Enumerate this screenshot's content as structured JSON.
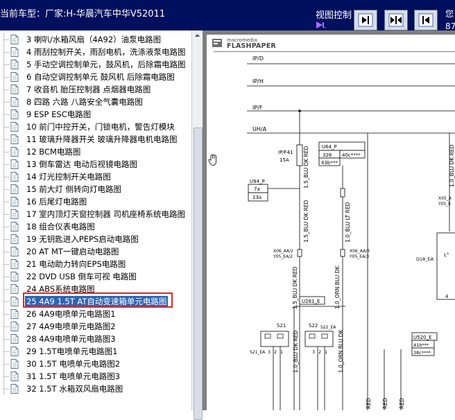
{
  "header": {
    "title_prefix": "当前车型：",
    "title_vehicle": "厂家:H-华晨汽车中华V52011",
    "view_control_label": "视图控制",
    "user_label_line1": "您",
    "user_label_line2": "87",
    "buttons": [
      "next-page-button",
      "fit-width-button",
      "prev-page-button"
    ]
  },
  "tree": {
    "items": [
      {
        "label": "3 喇叭/水箱风扇（4A92）油泵电路图"
      },
      {
        "label": "4 雨刮控制开关，雨刮电机，洗涤液泵电路图"
      },
      {
        "label": "5 手动空调控制单元，鼓风机，后除霜电路图"
      },
      {
        "label": "6 自动空调控制单元 鼓风机 后除霜电路图"
      },
      {
        "label": "7 收音机 胎压控制器 点烟器电路图"
      },
      {
        "label": "8 四路 六路 八路安全气囊电路图"
      },
      {
        "label": "9 ESP ESC电路图"
      },
      {
        "label": "10 前门中控开关，门锁电机，警告灯模块"
      },
      {
        "label": "11 玻璃升降器开关 玻璃升降器电机电路图"
      },
      {
        "label": "12 BCM电路图"
      },
      {
        "label": "13 倒车雷达 电动后视镜电路图"
      },
      {
        "label": "14 灯光控制开关电路图"
      },
      {
        "label": "15 前大灯 侧转向灯电路图"
      },
      {
        "label": "16 后尾灯电路图"
      },
      {
        "label": "17 室内顶灯天窗控制器 司机座椅系统电路图"
      },
      {
        "label": "18 组合仪表电路图"
      },
      {
        "label": "19 无钥匙进入PEPS启动电路图"
      },
      {
        "label": "20 AT MT一键启动电路图"
      },
      {
        "label": "21 电动助力转向EPS电路图"
      },
      {
        "label": "22 DVD USB 倒车可视 电路图"
      },
      {
        "label": "24 ABS系统电路图"
      },
      {
        "label": "25 4A9 1.5T AT自动变速箱单元电路图",
        "selected": true
      },
      {
        "label": "26 4A9电喷单元电路图1"
      },
      {
        "label": "27 4A9电喷单元电路图2"
      },
      {
        "label": "28 4A9电喷单元电路图3"
      },
      {
        "label": "29 1.5T电喷单元电路图1"
      },
      {
        "label": "30 1.5T 电喷单元电路图2"
      },
      {
        "label": "31 1.5T 电喷单元电路图3"
      },
      {
        "label": "32 1.5T 水箱双风扇电路图"
      }
    ]
  },
  "viewer": {
    "logo_brand": "macromedia",
    "logo_product": "FLASHPAPER",
    "diagram": {
      "rails": [
        "IP/D",
        "IP/H",
        "IP/F",
        "UH/A"
      ],
      "fuse_label": "IP/F41",
      "fuse_rating": "15A",
      "u94_label": "U94_P",
      "u94_pins": [
        "7a",
        "13a"
      ],
      "u64_label": "U64_P",
      "u64_pins": [
        "326",
        "40c****",
        "43b***"
      ],
      "connector_left_1": "X06_AA/2",
      "connector_left_2": "Y05_EA/2",
      "connector_right_1": "X06_AA/3",
      "connector_right_2": "Y05_EA/3",
      "wire_1": "1.5_BLU DK RED",
      "wire_2": "1.5_BLU DK RED",
      "wire_3": "1.0_BLU LT RED",
      "wire_4": "1.5_BLU DK RED",
      "wire_5": "1.0_ORN BLU DK",
      "wire_6": "1.0_BLU DK RED",
      "wire_7": "1.0_ORN BLU DK",
      "u281_label": "U281_E",
      "s21_label": "S21",
      "s21_sub": "S21_EA",
      "s22_label": "S22",
      "s22_sub": "S22_EA",
      "s21_pins": [
        "3",
        "2",
        "1"
      ],
      "s22_pins": [
        "3",
        "2",
        "1"
      ],
      "d18_label": "D18_EA",
      "u520_label": "U520_E",
      "u520_pins": [
        "41b***",
        "38c****"
      ],
      "edge_labels": [
        "X05_A",
        "Y05_E"
      ],
      "right_wire": "1.0_BLU DK RED",
      "pin_4": "4",
      "pin_l": "L°",
      "bottom_wires": [
        "RED",
        "RED",
        "RED"
      ]
    }
  }
}
